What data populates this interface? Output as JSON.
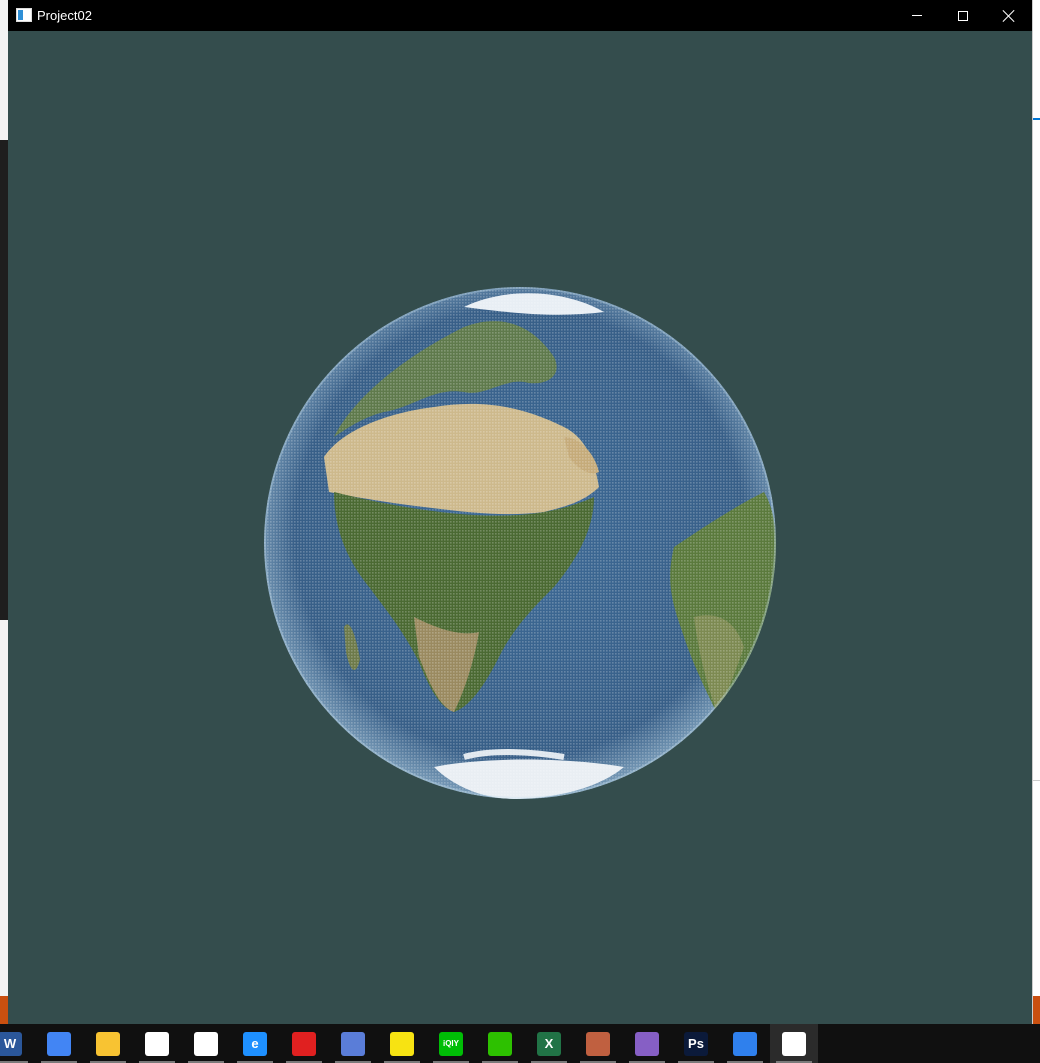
{
  "window": {
    "title": "Project02",
    "buttons": {
      "minimize": "minimize",
      "maximize": "maximize",
      "close": "close"
    }
  },
  "viewport": {
    "background": "#344d4d",
    "content": "textured-earth-sphere-point-cloud"
  },
  "taskbar": {
    "items": [
      {
        "name": "word-icon",
        "glyph": "W",
        "color": "#2b579a"
      },
      {
        "name": "chrome-icon",
        "glyph": "",
        "color": "#4285f4"
      },
      {
        "name": "file-explorer-icon",
        "glyph": "",
        "color": "#f8c332"
      },
      {
        "name": "microsoft-store-icon",
        "glyph": "",
        "color": "#ffffff"
      },
      {
        "name": "mail-icon",
        "glyph": "",
        "color": "#ffffff"
      },
      {
        "name": "browser-icon",
        "glyph": "e",
        "color": "#1e90ff"
      },
      {
        "name": "security-app-icon",
        "glyph": "",
        "color": "#e02020"
      },
      {
        "name": "feather-app-icon",
        "glyph": "",
        "color": "#5a7dd8"
      },
      {
        "name": "sticky-notes-icon",
        "glyph": "",
        "color": "#f7e312"
      },
      {
        "name": "iqiyi-icon",
        "glyph": "iQIY",
        "color": "#00be06"
      },
      {
        "name": "wechat-icon",
        "glyph": "",
        "color": "#2dc100"
      },
      {
        "name": "excel-icon",
        "glyph": "X",
        "color": "#217346"
      },
      {
        "name": "photo-app-icon",
        "glyph": "",
        "color": "#c06040"
      },
      {
        "name": "visual-studio-icon",
        "glyph": "",
        "color": "#865fc5"
      },
      {
        "name": "photoshop-icon",
        "glyph": "Ps",
        "color": "#0b1a3a"
      },
      {
        "name": "pen-app-icon",
        "glyph": "",
        "color": "#2f80ed"
      },
      {
        "name": "project02-app-icon",
        "glyph": "",
        "color": "#ffffff"
      }
    ]
  }
}
